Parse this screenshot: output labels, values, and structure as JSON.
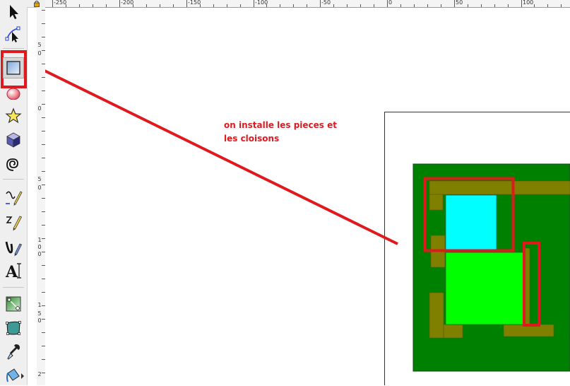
{
  "toolbar": {
    "tools": [
      {
        "name": "selector-tool",
        "icon": "arrow-cursor-icon"
      },
      {
        "name": "node-tool",
        "icon": "node-edit-icon"
      },
      {
        "name": "rectangle-tool",
        "icon": "rectangle-icon",
        "active": true
      },
      {
        "name": "ellipse-tool",
        "icon": "ellipse-icon"
      },
      {
        "name": "star-tool",
        "icon": "star-icon"
      },
      {
        "name": "3d-box-tool",
        "icon": "3d-box-icon"
      },
      {
        "name": "spiral-tool",
        "icon": "spiral-icon"
      },
      {
        "name": "pencil-tool",
        "icon": "pencil-icon"
      },
      {
        "name": "pen-tool",
        "icon": "pen-icon"
      },
      {
        "name": "calligraphy-tool",
        "icon": "calligraphy-icon"
      },
      {
        "name": "text-tool",
        "icon": "text-icon"
      },
      {
        "name": "gradient-tool",
        "icon": "gradient-icon"
      },
      {
        "name": "mesh-tool",
        "icon": "mesh-icon"
      },
      {
        "name": "dropper-tool",
        "icon": "dropper-icon"
      },
      {
        "name": "paint-bucket-tool",
        "icon": "paint-bucket-icon"
      }
    ],
    "text_tool_glyph": "A"
  },
  "rulers": {
    "horizontal_labels": [
      "-250",
      "-200",
      "-150",
      "-100",
      "-50",
      "0",
      "50",
      "100"
    ],
    "vertical_labels": [
      "5",
      "0",
      "0",
      "5",
      "0",
      "1",
      "0",
      "0",
      "1",
      "5",
      "0",
      "2"
    ]
  },
  "annotation": {
    "line1": "on installe les pieces et",
    "line2": "les cloisons",
    "color": "#e0191f"
  },
  "colors": {
    "highlight_red": "#e0191f",
    "ground_green": "#008000",
    "wall_olive": "#808000",
    "room_cyan": "#00ffff",
    "room_lime": "#00ff00"
  }
}
